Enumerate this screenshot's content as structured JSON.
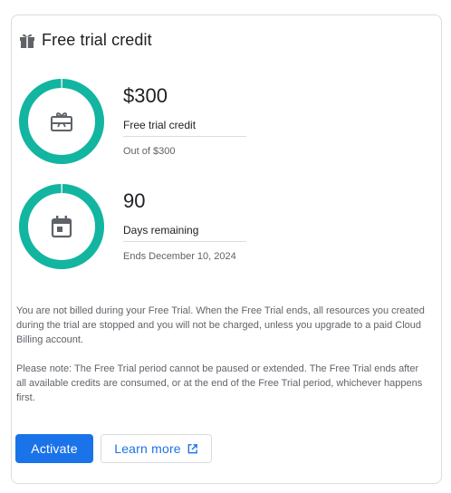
{
  "card": {
    "title": "Free trial credit",
    "title_icon": "gift-icon"
  },
  "credit": {
    "value": "$300",
    "label": "Free trial credit",
    "sub": "Out of $300",
    "icon": "gift-card-icon",
    "remaining_fraction": 1.0
  },
  "days": {
    "value": "90",
    "label": "Days remaining",
    "sub": "Ends December 10, 2024",
    "icon": "calendar-icon",
    "remaining_fraction": 1.0
  },
  "notes": {
    "paragraph1": "You are not billed during your Free Trial. When the Free Trial ends, all resources you created during the trial are stopped and you will not be charged, unless you upgrade to a paid Cloud Billing account.",
    "paragraph2": "Please note: The Free Trial period cannot be paused or extended. The Free Trial ends after all available credits are consumed, or at the end of the Free Trial period, whichever happens first."
  },
  "actions": {
    "activate_label": "Activate",
    "learn_more_label": "Learn more",
    "learn_more_icon": "open-in-new-icon"
  },
  "colors": {
    "ring": "#12b5a0",
    "ring_track": "#e8eaed",
    "primary": "#1a73e8",
    "icon": "#5f6368"
  }
}
